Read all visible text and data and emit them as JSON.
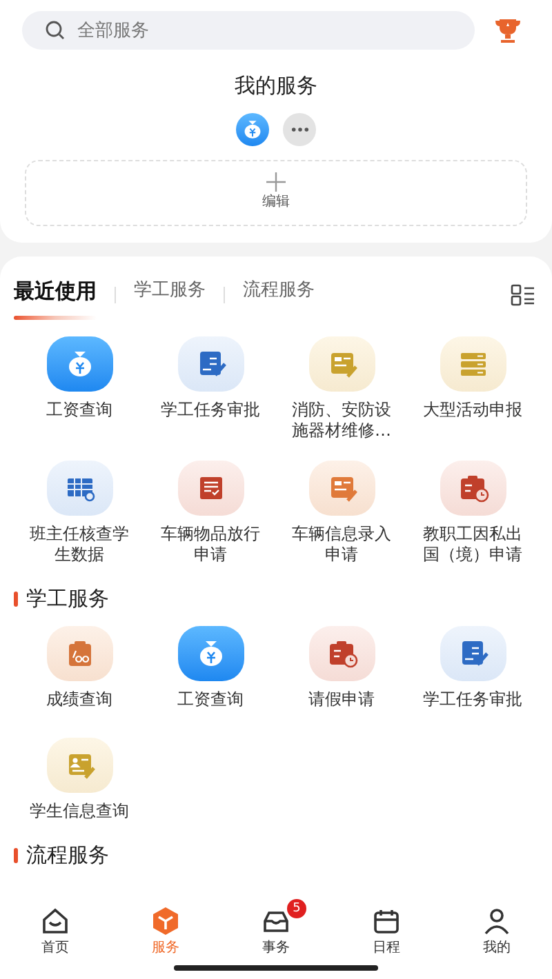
{
  "search": {
    "placeholder": "全部服务"
  },
  "my_services": {
    "title": "我的服务",
    "shortcuts": [
      {
        "kind": "moneybag"
      },
      {
        "kind": "more"
      }
    ],
    "edit_label": "编辑"
  },
  "tabs": [
    {
      "label": "最近使用",
      "selected": true
    },
    {
      "label": "学工服务",
      "selected": false
    },
    {
      "label": "流程服务",
      "selected": false
    }
  ],
  "recent": [
    {
      "label": "工资查询",
      "kind": "moneybag"
    },
    {
      "label": "学工任务审批",
      "kind": "doc-pen"
    },
    {
      "label": "消防、安防设施器材维修…",
      "kind": "form-pen-yellow"
    },
    {
      "label": "大型活动申报",
      "kind": "list"
    },
    {
      "label": "班主任核查学生数据",
      "kind": "table-search"
    },
    {
      "label": "车辆物品放行申请",
      "kind": "checklist"
    },
    {
      "label": "车辆信息录入申请",
      "kind": "form-pen-orange"
    },
    {
      "label": "教职工因私出国（境）申请",
      "kind": "calendar-clock"
    }
  ],
  "sections": [
    {
      "title": "学工服务",
      "items": [
        {
          "label": "成绩查询",
          "kind": "score"
        },
        {
          "label": "工资查询",
          "kind": "moneybag"
        },
        {
          "label": "请假申请",
          "kind": "calendar-clock"
        },
        {
          "label": "学工任务审批",
          "kind": "doc-pen"
        },
        {
          "label": "学生信息查询",
          "kind": "form-person"
        }
      ]
    },
    {
      "title": "流程服务"
    }
  ],
  "bottom_nav": [
    {
      "label": "首页",
      "kind": "home",
      "selected": false
    },
    {
      "label": "服务",
      "kind": "box",
      "selected": true
    },
    {
      "label": "事务",
      "kind": "tray",
      "selected": false,
      "badge": "5"
    },
    {
      "label": "日程",
      "kind": "calendar",
      "selected": false
    },
    {
      "label": "我的",
      "kind": "person",
      "selected": false
    }
  ]
}
